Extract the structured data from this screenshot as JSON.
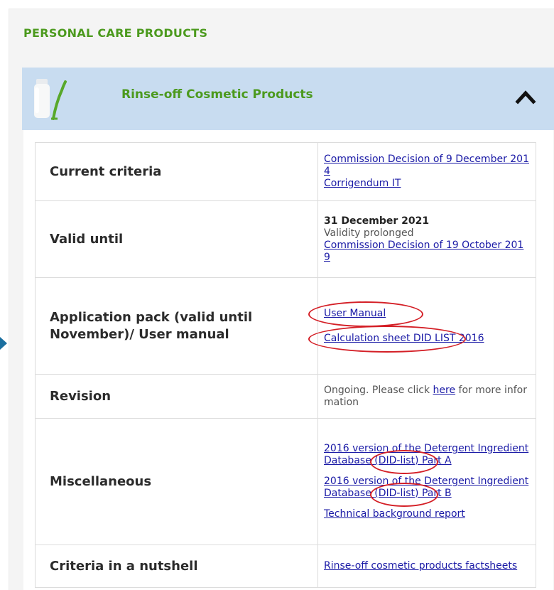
{
  "section": {
    "title": "PERSONAL CARE PRODUCTS"
  },
  "accordion": {
    "label": "Rinse-off Cosmetic Products",
    "expanded": true,
    "header_color": "#c8dcf0",
    "title_color": "#4c9a1e"
  },
  "highlight_color": "#d41f26",
  "rows": {
    "current": {
      "label": "Current criteria",
      "link1": "Commission Decision of 9 December 2014",
      "link2": "Corrigendum IT"
    },
    "valid": {
      "label": "Valid until",
      "date": "31 December 2021",
      "note": "Validity prolonged",
      "link": "Commission Decision of 19 October 2019"
    },
    "app": {
      "label": "Application pack (valid until November)/ User manual",
      "link1": "User Manual",
      "link2": "Calculation sheet DID LIST 2016"
    },
    "revision": {
      "label": "Revision",
      "text_before": "Ongoing. Please click ",
      "link": "here",
      "text_after": " for more information"
    },
    "misc": {
      "label": "Miscellaneous",
      "link_a_pre": "2016 version of the Detergent Ingredient Database ",
      "link_a_did": "(DID-list)",
      "link_a_post": " Part A",
      "link_b_pre": "2016 version of the Detergent Ingredient Database ",
      "link_b_did": "(DID-list)",
      "link_b_post": " Part B",
      "link_c": "Technical background report"
    },
    "nutshell": {
      "label": "Criteria in a nutshell",
      "link": "Rinse-off cosmetic products factsheets"
    }
  }
}
